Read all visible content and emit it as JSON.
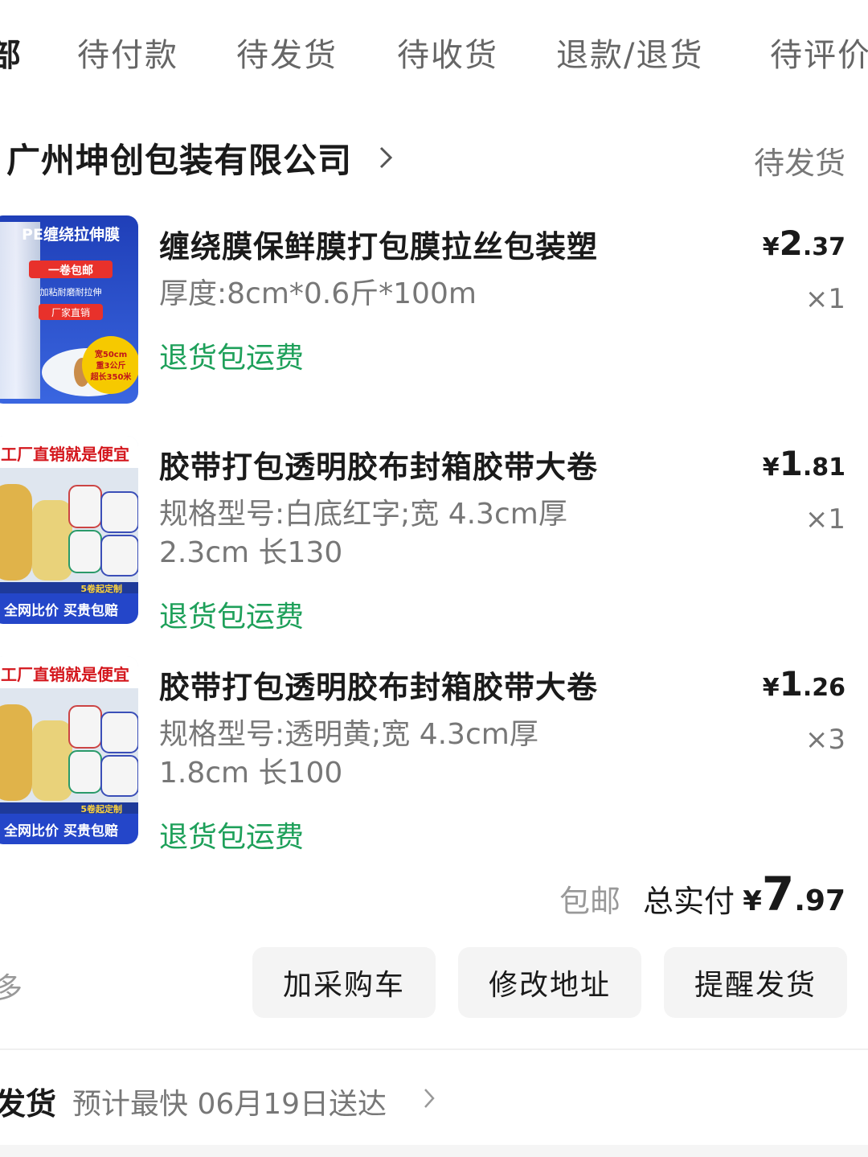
{
  "tabs": [
    "部",
    "待付款",
    "待发货",
    "待收货",
    "退款/退货",
    "待评价"
  ],
  "shop": {
    "name": "广州坤创包装有限公司",
    "status": "待发货"
  },
  "items": [
    {
      "title": "缠绕膜保鲜膜打包膜拉丝包装塑",
      "spec": "厚度:8cm*0.6斤*100m",
      "tag": "退货包运费",
      "price_symbol": "¥",
      "price_int": "2",
      "price_dec": ".37",
      "qty": "×1",
      "image": {
        "banner": "PE缠绕拉伸膜",
        "badge1": "一卷包邮",
        "line2": "加粘耐磨耐拉伸",
        "badge2": "厂家直销",
        "circle": [
          "宽50cm",
          "重3公斤",
          "超长350米"
        ]
      }
    },
    {
      "title": "胶带打包透明胶布封箱胶带大卷",
      "spec": "规格型号:白底红字;宽 4.3cm厚 2.3cm 长130",
      "tag": "退货包运费",
      "price_symbol": "¥",
      "price_int": "1",
      "price_dec": ".81",
      "qty": "×1",
      "image": {
        "top": "工厂直销就是便宜",
        "corner": "5卷起定制",
        "bottom": "全网比价 买贵包赔"
      }
    },
    {
      "title": "胶带打包透明胶布封箱胶带大卷",
      "spec": "规格型号:透明黄;宽 4.3cm厚 1.8cm 长100",
      "tag": "退货包运费",
      "price_symbol": "¥",
      "price_int": "1",
      "price_dec": ".26",
      "qty": "×3",
      "image": {
        "top": "工厂直销就是便宜",
        "corner": "5卷起定制",
        "bottom": "全网比价 买贵包赔"
      }
    }
  ],
  "total": {
    "free_shipping": "包邮",
    "label": "总实付",
    "symbol": "¥",
    "int": "7",
    "dec": ".97"
  },
  "actions": {
    "more": "多",
    "add_cart": "加采购车",
    "modify_address": "修改地址",
    "remind_ship": "提醒发货"
  },
  "delivery": {
    "label": "发货",
    "info": "预计最快 06月19日送达"
  },
  "colors": {
    "green_tag": "#1ea05a",
    "button_bg": "#f4f4f4"
  }
}
